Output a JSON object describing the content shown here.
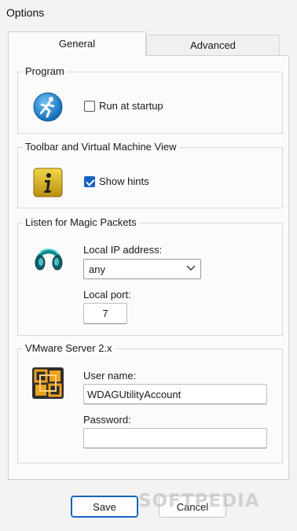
{
  "window": {
    "title": "Options"
  },
  "tabs": [
    {
      "label": "General",
      "active": true
    },
    {
      "label": "Advanced",
      "active": false
    }
  ],
  "program": {
    "legend": "Program",
    "icon": "running-person-icon",
    "run_at_startup": {
      "label": "Run at startup",
      "checked": false
    }
  },
  "toolbar": {
    "legend": "Toolbar and Virtual Machine View",
    "icon": "info-icon",
    "show_hints": {
      "label": "Show hints",
      "checked": true
    }
  },
  "magic_packets": {
    "legend": "Listen for Magic Packets",
    "icon": "headphones-icon",
    "ip_label": "Local IP address:",
    "ip_value": "any",
    "port_label": "Local port:",
    "port_value": "7"
  },
  "vmware": {
    "legend": "VMware Server 2.x",
    "icon": "vmware-icon",
    "user_label": "User name:",
    "user_value": "WDAGUtilityAccount",
    "password_label": "Password:",
    "password_value": ""
  },
  "buttons": {
    "save": "Save",
    "cancel": "Cancel"
  },
  "watermark": "SOFTPEDIA",
  "colors": {
    "accent": "#1565c0",
    "window_bg": "#f3f3f3",
    "panel_bg": "#fbfbfb"
  }
}
